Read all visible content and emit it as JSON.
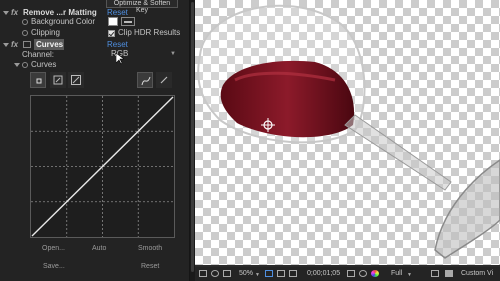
{
  "effects_panel": {
    "top_button_label": "Optimize & Soften Key",
    "remove_matting": {
      "fx_label": "fx",
      "name": "Remove ...r Matting",
      "reset_label": "Reset",
      "params": [
        {
          "label": "Background Color"
        },
        {
          "label": "Clipping",
          "checkbox_label": "Clip HDR Results",
          "checked": true
        }
      ]
    },
    "curves": {
      "fx_label": "fx",
      "name": "Curves",
      "reset_label": "Reset",
      "channel_label": "Channel:",
      "channel_value": "RGB",
      "sub_label": "Curves",
      "buttons": {
        "open": "Open...",
        "auto": "Auto",
        "smooth": "Smooth",
        "save": "Save...",
        "reset": "Reset"
      }
    }
  },
  "viewer": {
    "status": {
      "zoom": "50%",
      "timecode": "0;00;01;05",
      "resolution": "Full",
      "view": "Custom Vi"
    }
  },
  "colors": {
    "panel_bg": "#232323",
    "accent_link": "#4f8fe0",
    "wine": "#7a1020"
  }
}
